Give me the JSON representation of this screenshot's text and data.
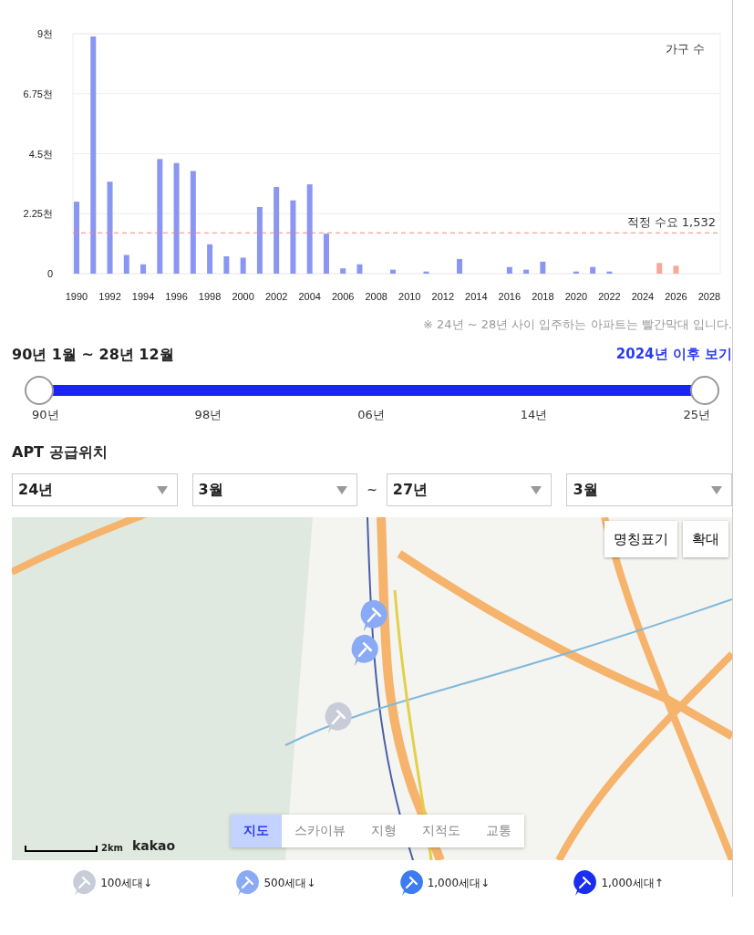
{
  "chart": {
    "chart_data": {
      "type": "bar",
      "ylabel": "가구 수",
      "categories": [
        "1990",
        null,
        "1992",
        null,
        "1994",
        null,
        "1996",
        null,
        "1998",
        null,
        "2000",
        null,
        "2002",
        null,
        "2004",
        null,
        "2006",
        null,
        "2008",
        null,
        "2010",
        null,
        "2012",
        null,
        "2014",
        null,
        "2016",
        null,
        "2018",
        null,
        "2020",
        null,
        "2022",
        null,
        "2024",
        null,
        "2026",
        null,
        "2028"
      ],
      "series": [
        {
          "color": "#8a96f2",
          "values": [
            2.7,
            8.9,
            3.45,
            0.7,
            0.35,
            4.3,
            4.15,
            3.85,
            1.1,
            0.65,
            0.6,
            2.5,
            3.25,
            2.75,
            3.35,
            1.5,
            0.2,
            0.35,
            0,
            0.15,
            0,
            0.08,
            0,
            0.55,
            0,
            0,
            0.25,
            0.15,
            0.45,
            0,
            0.08,
            0.25,
            0.08,
            0,
            0,
            null,
            null,
            null,
            null
          ]
        },
        {
          "color": "#f6a99a",
          "values": [
            null,
            null,
            null,
            null,
            null,
            null,
            null,
            null,
            null,
            null,
            null,
            null,
            null,
            null,
            null,
            null,
            null,
            null,
            null,
            null,
            null,
            null,
            null,
            null,
            null,
            null,
            null,
            null,
            null,
            null,
            null,
            null,
            null,
            null,
            0,
            0.4,
            0.3,
            0,
            0
          ]
        }
      ],
      "ylim": [
        0,
        9
      ],
      "yticks": [
        {
          "value": 0,
          "label": "0"
        },
        {
          "value": 2.25,
          "label": "2.25천"
        },
        {
          "value": 4.5,
          "label": "4.5천"
        },
        {
          "value": 6.75,
          "label": "6.75천"
        },
        {
          "value": 9,
          "label": "9천"
        }
      ],
      "grid": true,
      "ref_lines": [
        {
          "axis": "y",
          "value": 1.532,
          "label": "적정 수요 1,532"
        }
      ]
    },
    "note": "※ 24년 ~ 28년 사이 입주하는 아파트는 빨간막대 입니다."
  },
  "range": {
    "title": "90년 1월 ~ 28년 12월",
    "link": "2024년 이후 보기",
    "thumbs": [
      {
        "level": 0
      },
      {
        "level": 1
      }
    ],
    "ticks": [
      "90년",
      "98년",
      "06년",
      "14년",
      "25년"
    ]
  },
  "supply": {
    "title": "APT 공급위치",
    "filters": [
      {
        "kind": "select",
        "value": "24년"
      },
      {
        "kind": "select",
        "value": "3월"
      },
      {
        "kind": "separator",
        "value": "~"
      },
      {
        "kind": "select",
        "value": "27년"
      },
      {
        "kind": "select",
        "value": "3월"
      }
    ],
    "map": {
      "buttons": [
        "명칭표기",
        "확대"
      ],
      "scale": "2km",
      "logo": "kakao",
      "markers": [
        {
          "color": "#8aaaf5"
        },
        {
          "color": "#8aaaf5"
        },
        {
          "color": "#c8ccd8"
        }
      ],
      "map_types": [
        {
          "label": "지도",
          "selected": true
        },
        {
          "label": "스카이뷰",
          "selected": false
        },
        {
          "label": "지형",
          "selected": false
        },
        {
          "label": "지적도",
          "selected": false
        },
        {
          "label": "교통",
          "selected": false
        }
      ]
    },
    "legend": [
      {
        "label": "100세대↓",
        "color": "#c8ccd8"
      },
      {
        "label": "500세대↓",
        "color": "#8aaaf5"
      },
      {
        "label": "1,000세대↓",
        "color": "#3d7cf0"
      },
      {
        "label": "1,000세대↑",
        "color": "#1a2ef0"
      }
    ]
  }
}
